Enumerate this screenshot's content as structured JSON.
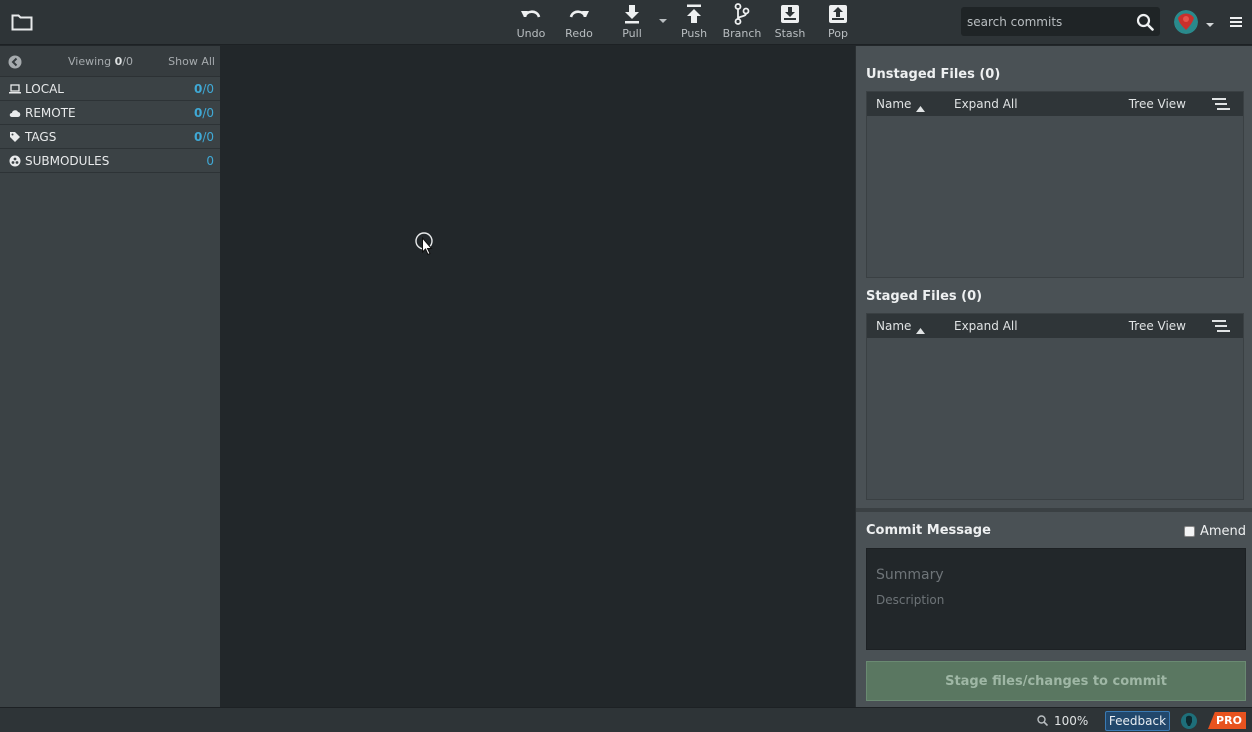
{
  "toolbar": {
    "buttons": [
      {
        "label": "Undo",
        "icon": "undo-icon"
      },
      {
        "label": "Redo",
        "icon": "redo-icon"
      },
      {
        "label": "Pull",
        "icon": "pull-icon"
      },
      {
        "label": "Push",
        "icon": "push-icon"
      },
      {
        "label": "Branch",
        "icon": "branch-icon"
      },
      {
        "label": "Stash",
        "icon": "stash-icon"
      },
      {
        "label": "Pop",
        "icon": "pop-icon"
      }
    ],
    "search_placeholder": "search commits"
  },
  "left_panel": {
    "viewing_prefix": "Viewing ",
    "viewing_count": "0",
    "viewing_total": "/0",
    "show_all": "Show All",
    "sections": [
      {
        "label": "LOCAL",
        "count": "0",
        "total": "/0",
        "icon": "laptop-icon"
      },
      {
        "label": "REMOTE",
        "count": "0",
        "total": "/0",
        "icon": "cloud-icon"
      },
      {
        "label": "TAGS",
        "count": "0",
        "total": "/0",
        "icon": "tag-icon"
      },
      {
        "label": "SUBMODULES",
        "count": "",
        "total": "0",
        "icon": "submodule-icon"
      }
    ]
  },
  "right_panel": {
    "unstaged_title": "Unstaged Files (0)",
    "staged_title": "Staged Files (0)",
    "col_name": "Name",
    "expand_all": "Expand All",
    "tree_view": "Tree View",
    "commit_title": "Commit Message",
    "amend_label": "Amend",
    "summary_placeholder": "Summary",
    "description_placeholder": "Description",
    "stage_button": "Stage files/changes to commit"
  },
  "status_bar": {
    "zoom": "100%",
    "feedback": "Feedback",
    "pro": "PRO"
  },
  "colors": {
    "accent_blue": "#3fa9d6",
    "pro_orange": "#e8531f",
    "stage_green": "#5a7761",
    "feedback_blue": "#21476b"
  }
}
